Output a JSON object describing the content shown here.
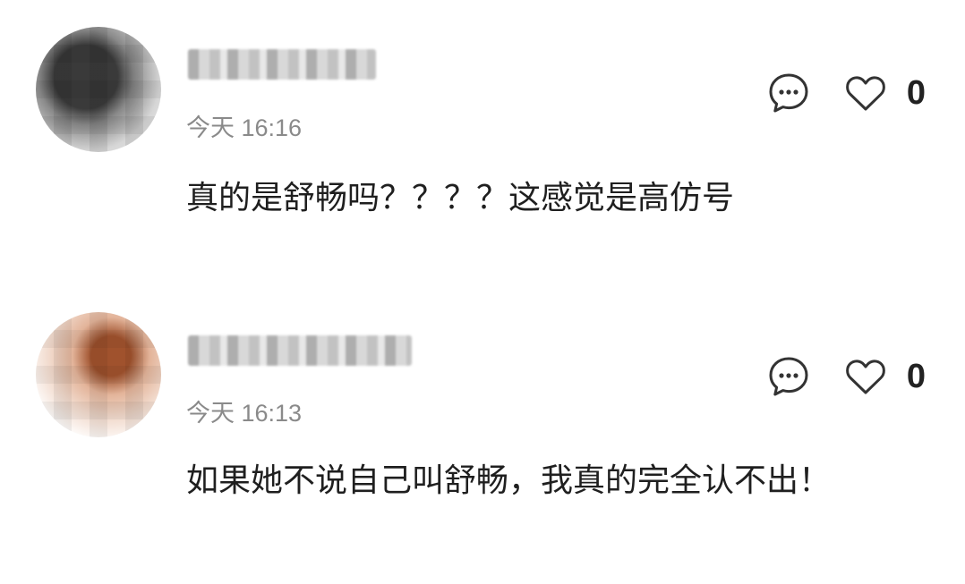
{
  "comments": [
    {
      "time": "今天 16:16",
      "text": "真的是舒畅吗？？？？这感觉是高仿号",
      "like_count": "0",
      "icons": {
        "comment": "comment-bubble-icon",
        "like": "heart-outline-icon"
      }
    },
    {
      "time": "今天 16:13",
      "text": "如果她不说自己叫舒畅，我真的完全认不出！",
      "like_count": "0",
      "icons": {
        "comment": "comment-bubble-icon",
        "like": "heart-outline-icon"
      }
    }
  ],
  "colors": {
    "text": "#1f1f1f",
    "meta": "#8a8a8a",
    "icon": "#333333"
  }
}
